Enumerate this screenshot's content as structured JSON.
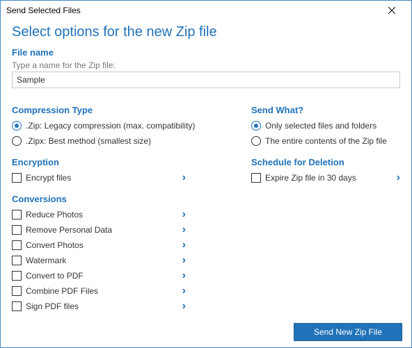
{
  "window": {
    "title": "Send Selected Files"
  },
  "heading": "Select options for the new Zip file",
  "filename": {
    "label": "File name",
    "hint": "Type a name for the Zip file:",
    "value": "Sample"
  },
  "compression": {
    "label": "Compression Type",
    "options": [
      ".Zip: Legacy compression (max. compatibility)",
      ".Zipx: Best method (smallest size)"
    ]
  },
  "encryption": {
    "label": "Encryption",
    "option": "Encrypt files"
  },
  "conversions": {
    "label": "Conversions",
    "items": [
      "Reduce Photos",
      "Remove Personal Data",
      "Convert Photos",
      "Watermark",
      "Convert to PDF",
      "Combine PDF Files",
      "Sign PDF files"
    ]
  },
  "sendwhat": {
    "label": "Send What?",
    "options": [
      "Only selected files and folders",
      "The entire contents of the Zip file"
    ]
  },
  "schedule": {
    "label": "Schedule for Deletion",
    "option": "Expire Zip file in 30 days"
  },
  "footer": {
    "button": "Send New Zip File"
  }
}
